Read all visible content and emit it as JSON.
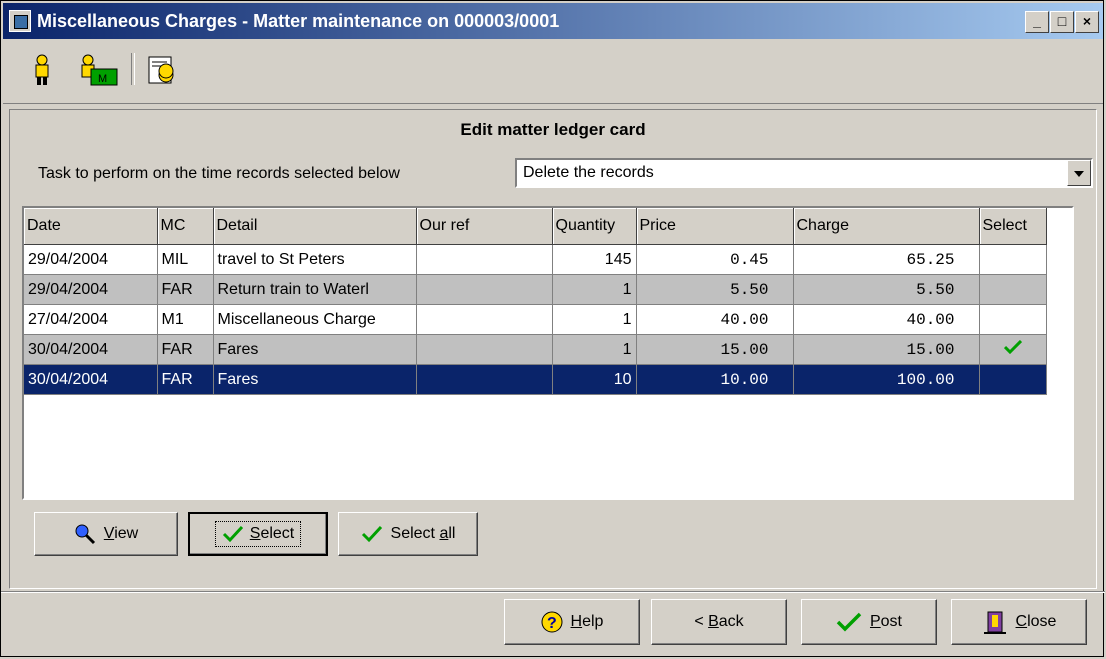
{
  "window": {
    "title": "Miscellaneous Charges - Matter maintenance on 000003/0001",
    "minimize": "_",
    "maximize": "□",
    "close": "×"
  },
  "toolbar": {
    "icons": [
      "client-icon",
      "matter-icon",
      "charges-icon"
    ]
  },
  "panel": {
    "heading": "Edit matter ledger card",
    "task_label": "Task to perform on the time records selected below",
    "task_value": "Delete the records"
  },
  "grid": {
    "columns": [
      "Date",
      "MC",
      "Detail",
      "Our ref",
      "Quantity",
      "Price",
      "Charge",
      "Select"
    ],
    "rows": [
      {
        "date": "29/04/2004",
        "mc": "MIL",
        "detail": "travel to St Peters",
        "ref": "",
        "qty": "145",
        "price": "0.45",
        "charge": "65.25",
        "selected": false
      },
      {
        "date": "29/04/2004",
        "mc": "FAR",
        "detail": "Return train to Waterl",
        "ref": "",
        "qty": "1",
        "price": "5.50",
        "charge": "5.50",
        "selected": false
      },
      {
        "date": "27/04/2004",
        "mc": "M1",
        "detail": "Miscellaneous Charge",
        "ref": "",
        "qty": "1",
        "price": "40.00",
        "charge": "40.00",
        "selected": false
      },
      {
        "date": "30/04/2004",
        "mc": "FAR",
        "detail": "Fares",
        "ref": "",
        "qty": "1",
        "price": "15.00",
        "charge": "15.00",
        "selected": true
      },
      {
        "date": "30/04/2004",
        "mc": "FAR",
        "detail": "Fares",
        "ref": "",
        "qty": "10",
        "price": "10.00",
        "charge": "100.00",
        "selected": false
      }
    ]
  },
  "actions": {
    "view": {
      "pre": "",
      "u": "V",
      "post": "iew"
    },
    "select": {
      "pre": "",
      "u": "S",
      "post": "elect"
    },
    "select_all": {
      "pre": "Select ",
      "u": "a",
      "post": "ll"
    }
  },
  "footer": {
    "help": {
      "pre": "",
      "u": "H",
      "post": "elp"
    },
    "back": {
      "pre": "< ",
      "u": "B",
      "post": "ack"
    },
    "post": {
      "pre": "",
      "u": "P",
      "post": "ost"
    },
    "close": {
      "pre": "",
      "u": "C",
      "post": "lose"
    }
  },
  "colors": {
    "selection": "#0a246a",
    "check": "#00a000"
  }
}
